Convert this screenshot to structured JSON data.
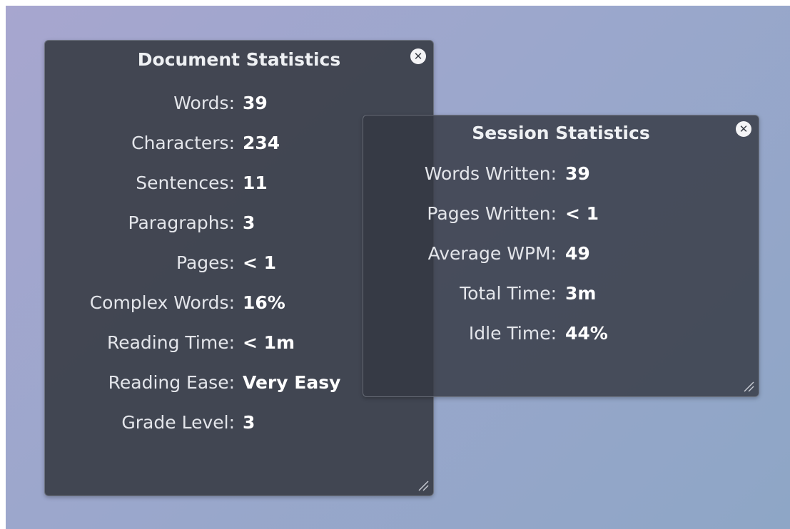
{
  "document_panel": {
    "title": "Document Statistics",
    "close_icon": "close-icon",
    "stats": [
      {
        "label": "Words:",
        "value": "39"
      },
      {
        "label": "Characters:",
        "value": "234"
      },
      {
        "label": "Sentences:",
        "value": "11"
      },
      {
        "label": "Paragraphs:",
        "value": "3"
      },
      {
        "label": "Pages:",
        "value": "< 1"
      },
      {
        "label": "Complex Words:",
        "value": "16%"
      },
      {
        "label": "Reading Time:",
        "value": "< 1m"
      },
      {
        "label": "Reading Ease:",
        "value": "Very Easy"
      },
      {
        "label": "Grade Level:",
        "value": "3"
      }
    ]
  },
  "session_panel": {
    "title": "Session Statistics",
    "close_icon": "close-icon",
    "stats": [
      {
        "label": "Words Written:",
        "value": "39"
      },
      {
        "label": "Pages Written:",
        "value": "< 1"
      },
      {
        "label": "Average WPM:",
        "value": "49"
      },
      {
        "label": "Total Time:",
        "value": "3m"
      },
      {
        "label": "Idle Time:",
        "value": "44%"
      }
    ]
  },
  "colors": {
    "panel_bg": "#3a3e48",
    "text": "#e9eaee",
    "desktop_start": "#a7a6cf",
    "desktop_end": "#8ea6c6"
  }
}
